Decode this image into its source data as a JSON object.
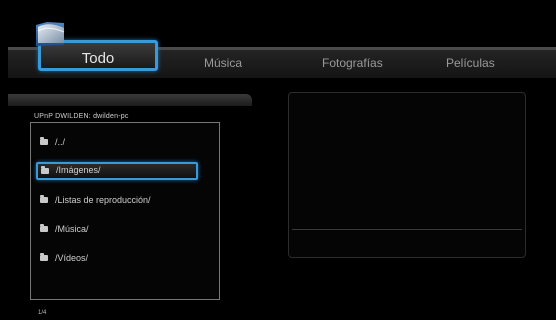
{
  "tabs": {
    "todo": "Todo",
    "musica": "Música",
    "fotografias": "Fotografías",
    "peliculas": "Películas"
  },
  "browser": {
    "path": "UPnP   DWILDEN: dwilden-pc",
    "items": [
      {
        "label": "/../",
        "selected": false
      },
      {
        "label": "/Imágenes/",
        "selected": true
      },
      {
        "label": "/Listas de reproducción/",
        "selected": false
      },
      {
        "label": "/Música/",
        "selected": false
      },
      {
        "label": "/Vídeos/",
        "selected": false
      }
    ],
    "page": "1/4"
  },
  "colors": {
    "accent": "#3a9ad8",
    "background": "#000000"
  },
  "icons": {
    "category": "folder-icon",
    "item": "folder-icon"
  }
}
